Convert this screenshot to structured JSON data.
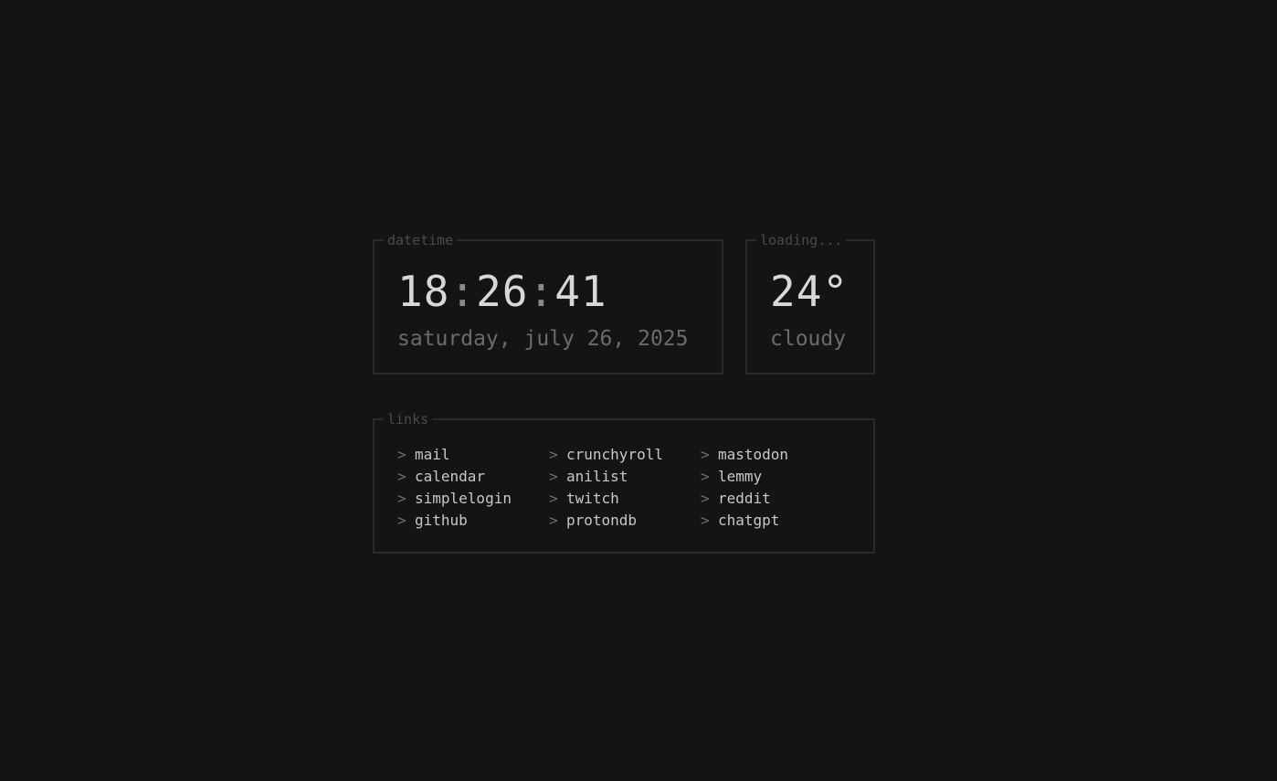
{
  "datetime": {
    "legend": "datetime",
    "hours": "18",
    "minutes": "26",
    "seconds": "41",
    "separator": ":",
    "date": "saturday, july 26, 2025"
  },
  "weather": {
    "legend": "loading...",
    "temperature": "24°",
    "condition": "cloudy"
  },
  "links": {
    "legend": "links",
    "arrow": ">",
    "columns": [
      [
        "mail",
        "calendar",
        "simplelogin",
        "github"
      ],
      [
        "crunchyroll",
        "anilist",
        "twitch",
        "protondb"
      ],
      [
        "mastodon",
        "lemmy",
        "reddit",
        "chatgpt"
      ]
    ]
  },
  "colors": {
    "background": "#141414",
    "border": "#2a2a2a",
    "primary_text": "#d8d8d8",
    "muted_text": "#6b6b6b",
    "legend_text": "#4a4a4a"
  }
}
